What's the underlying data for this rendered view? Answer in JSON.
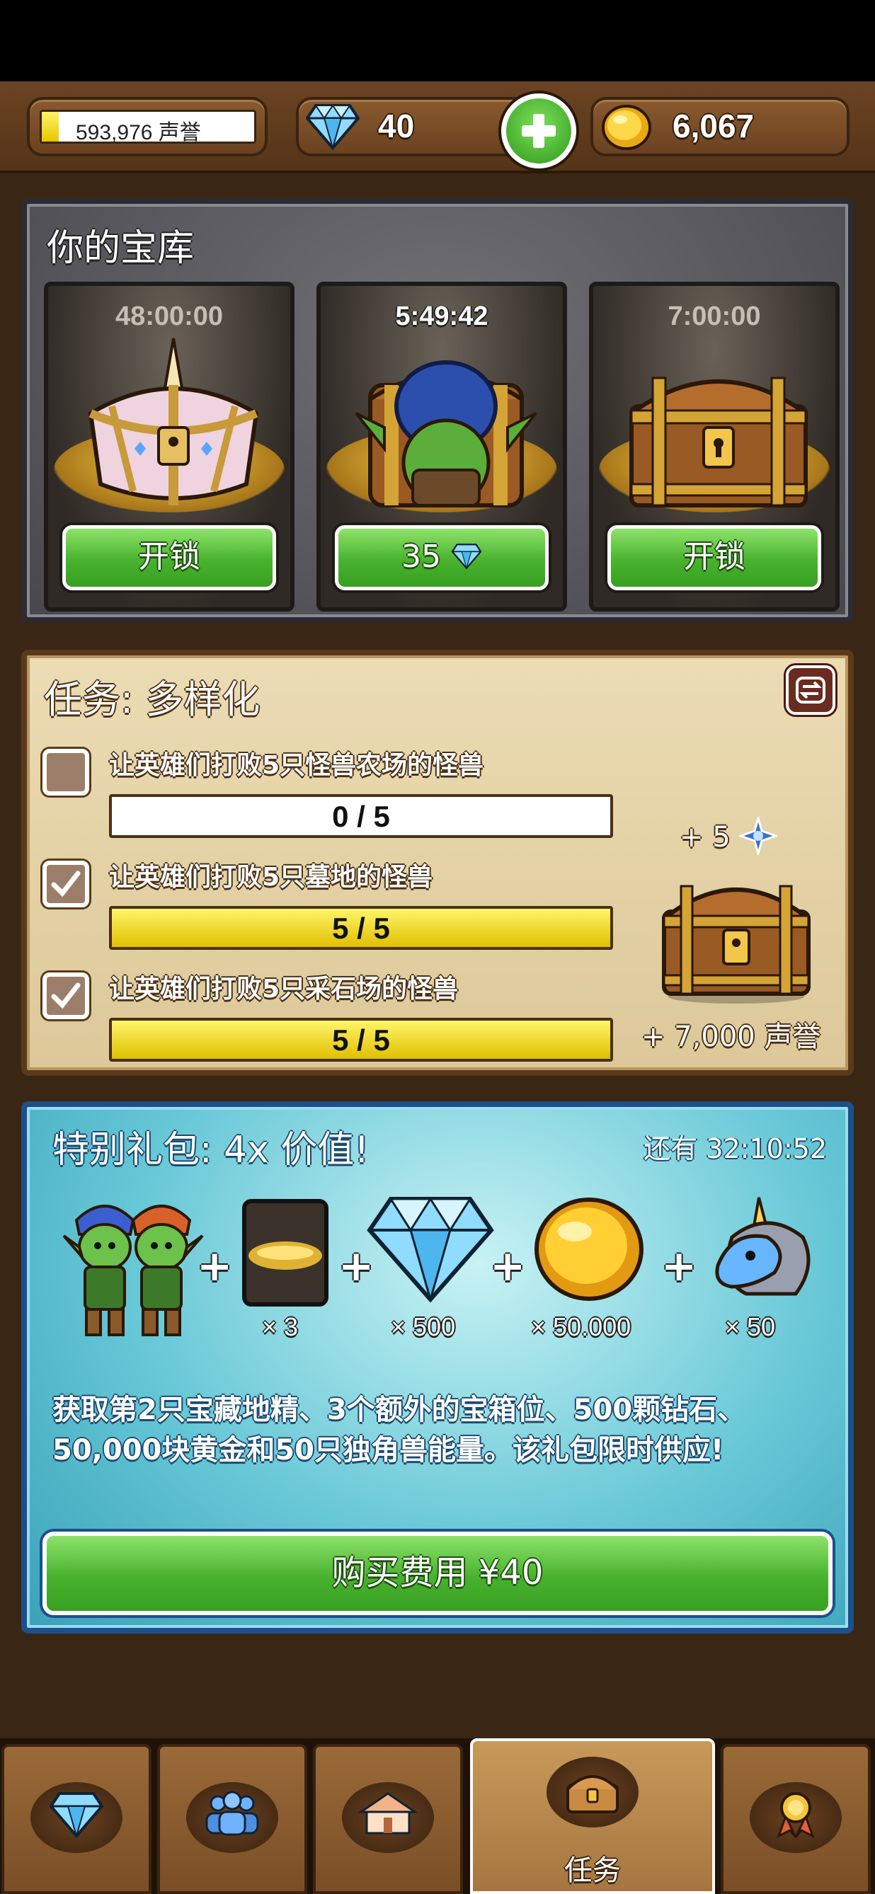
{
  "resources": {
    "reputation": {
      "value": "593,976",
      "unit": "声誉",
      "fill": 0.08
    },
    "gems": "40",
    "gold": "6,067"
  },
  "vault": {
    "title": "你的宝库",
    "slots": [
      {
        "timer": "48:00:00",
        "button": "开锁",
        "chest": "unicorn-chest"
      },
      {
        "timer": "5:49:42",
        "button": "35",
        "chest": "goblin-chest"
      },
      {
        "timer": "7:00:00",
        "button": "开锁",
        "chest": "wooden-chest"
      }
    ]
  },
  "quest": {
    "title": "任务: 多样化",
    "tasks": [
      {
        "label": "让英雄们打败5只怪兽农场的怪兽",
        "progress": "0 / 5",
        "done": false,
        "fill": 0.0
      },
      {
        "label": "让英雄们打败5只墓地的怪兽",
        "progress": "5 / 5",
        "done": true,
        "fill": 1.0
      },
      {
        "label": "让英雄们打败5只采石场的怪兽",
        "progress": "5 / 5",
        "done": true,
        "fill": 1.0
      }
    ],
    "reward_gems": "+ 5",
    "reward_rep": "+ 7,000 声誉"
  },
  "offer": {
    "title": "特别礼包: 4x 价值!",
    "timer": "还有 32:10:52",
    "items": [
      {
        "icon": "goblin-pair-icon",
        "qty": ""
      },
      {
        "icon": "chest-slot-card-icon",
        "qty": "× 3"
      },
      {
        "icon": "diamond-icon",
        "qty": "× 500"
      },
      {
        "icon": "gold-coin-icon",
        "qty": "× 50.000"
      },
      {
        "icon": "unicorn-icon",
        "qty": "× 50"
      }
    ],
    "plus": "+",
    "description": "获取第2只宝藏地精、3个额外的宝箱位、500颗钻石、50,000块黄金和50只独角兽能量。该礼包限时供应!",
    "buy_label": "购买费用 ¥40"
  },
  "nav": {
    "tabs": [
      {
        "icon": "gems-icon"
      },
      {
        "icon": "heroes-icon"
      },
      {
        "icon": "town-icon"
      },
      {
        "icon": "chest-icon",
        "label": "任务",
        "active": true
      },
      {
        "icon": "medal-icon"
      }
    ]
  },
  "colors": {
    "green_button": "#48b22e",
    "progress_yellow": "#e8c600",
    "offer_blue": "#1d4f8a",
    "wood": "#6b4422"
  }
}
